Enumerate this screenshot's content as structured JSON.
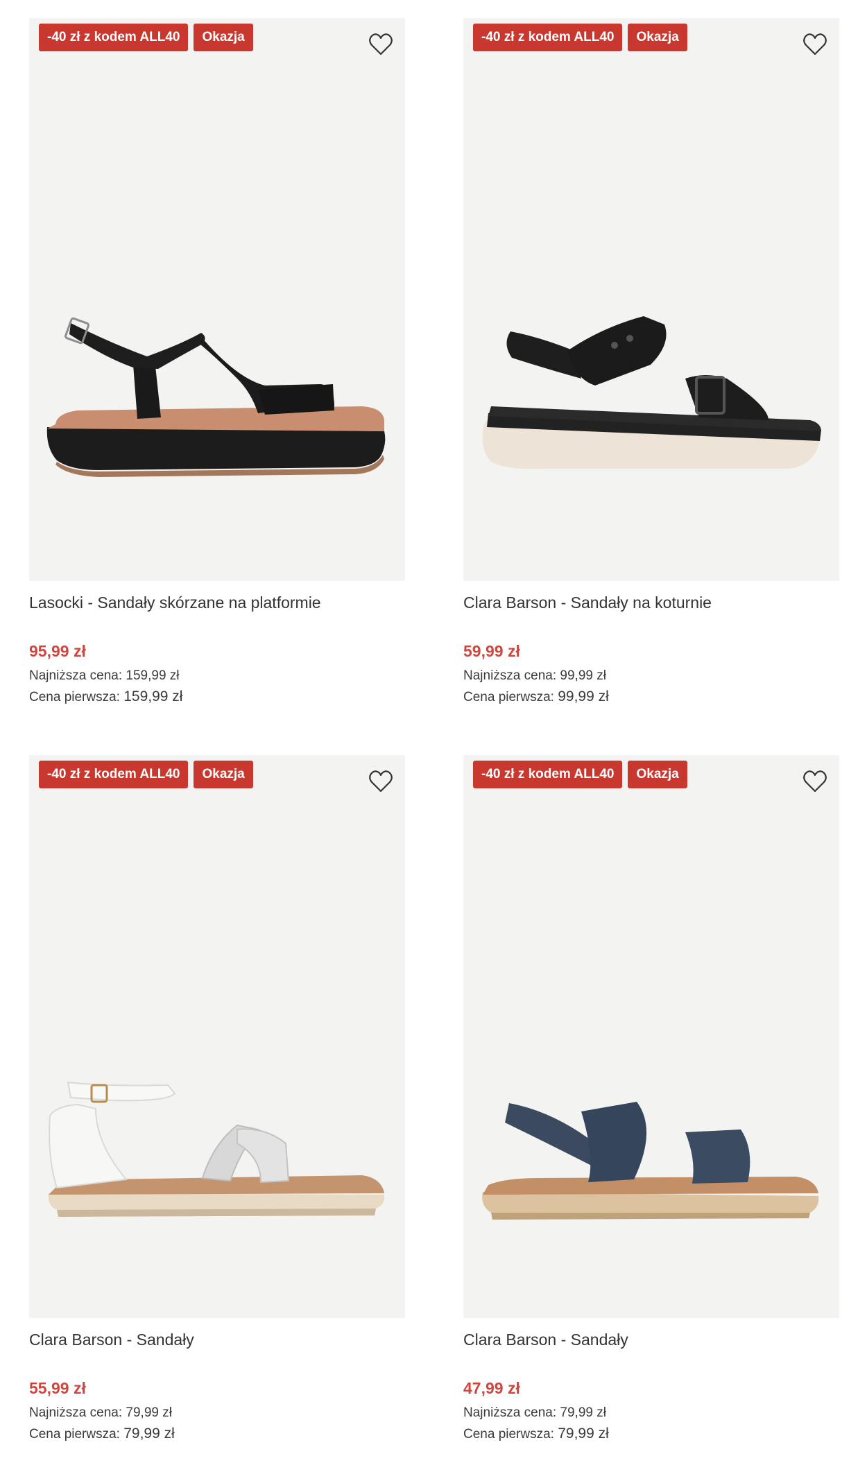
{
  "products": [
    {
      "badge_code": "-40 zł z kodem ALL40",
      "badge_deal": "Okazja",
      "image": "black-platform-sandal",
      "title": "Lasocki - Sandały skórzane na platformie",
      "price": "95,99 zł",
      "lowest_label": "Najniższa cena:",
      "lowest_value": "159,99 zł",
      "first_label": "Cena pierwsza:",
      "first_value": "159,99 zł"
    },
    {
      "badge_code": "-40 zł z kodem ALL40",
      "badge_deal": "Okazja",
      "image": "black-wedge-sandal",
      "title": "Clara Barson - Sandały na koturnie",
      "price": "59,99 zł",
      "lowest_label": "Najniższa cena:",
      "lowest_value": "99,99 zł",
      "first_label": "Cena pierwsza:",
      "first_value": "99,99 zł"
    },
    {
      "badge_code": "-40 zł z kodem ALL40",
      "badge_deal": "Okazja",
      "image": "white-glitter-sandal",
      "title": "Clara Barson - Sandały",
      "price": "55,99 zł",
      "lowest_label": "Najniższa cena:",
      "lowest_value": "79,99 zł",
      "first_label": "Cena pierwsza:",
      "first_value": "79,99 zł"
    },
    {
      "badge_code": "-40 zł z kodem ALL40",
      "badge_deal": "Okazja",
      "image": "navy-strap-sandal",
      "title": "Clara Barson - Sandały",
      "price": "47,99 zł",
      "lowest_label": "Najniższa cena:",
      "lowest_value": "79,99 zł",
      "first_label": "Cena pierwsza:",
      "first_value": "79,99 zł"
    }
  ],
  "icons": {
    "favorite": "heart-icon"
  },
  "colors": {
    "badge": "#c8382f",
    "price": "#d0463e",
    "image_bg": "#f3f3f2"
  }
}
